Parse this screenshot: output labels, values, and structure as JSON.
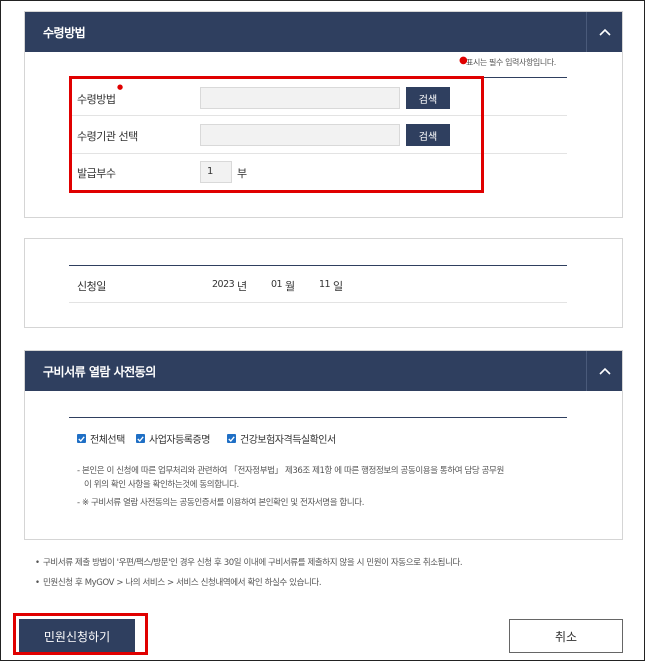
{
  "receipt_panel": {
    "title": "수령방법",
    "required_note": "표시는 필수 입력사항입니다.",
    "rows": [
      {
        "label": "수령방법",
        "button": "검색"
      },
      {
        "label": "수령기관 선택",
        "button": "검색"
      },
      {
        "label": "발급부수",
        "value": "1",
        "unit": "부"
      }
    ]
  },
  "date_panel": {
    "label": "신청일",
    "year": "2023",
    "year_unit": "년",
    "month": "01",
    "month_unit": "월",
    "day": "11",
    "day_unit": "일"
  },
  "consent_panel": {
    "title": "구비서류 열람 사전동의",
    "checkboxes": [
      "전체선택",
      "사업자등록증명",
      "건강보험자격득실확인서"
    ],
    "notes": [
      "- 본인은 이 신청에 따른 업무처리와 관련하여 「전자정부법」 제36조 제1항 에 따른 행정정보의 공동이용을 통하여 담당 공무원",
      "이 위의 확인 사항을 확인하는것에 동의합니다.",
      "- ※ 구비서류 열람 사전동의는 공동인증서를 이용하여 본인확인 및 전자서명을 합니다."
    ]
  },
  "bottom_notes": [
    "구비서류 제출 방법이 '우편/팩스/방문'인 경우 신청 후 30일 이내에 구비서류를 제출하지 않을 시 민원이 자동으로 취소됩니다.",
    "민원신청 후 MyGOV > 나의 서비스 > 서비스 신청내역에서 확인 하실수 있습니다."
  ],
  "actions": {
    "submit": "민원신청하기",
    "cancel": "취소"
  },
  "colors": {
    "header": "#2f3f5f",
    "highlight": "#e00000",
    "checkbox": "#1f6fc5"
  }
}
